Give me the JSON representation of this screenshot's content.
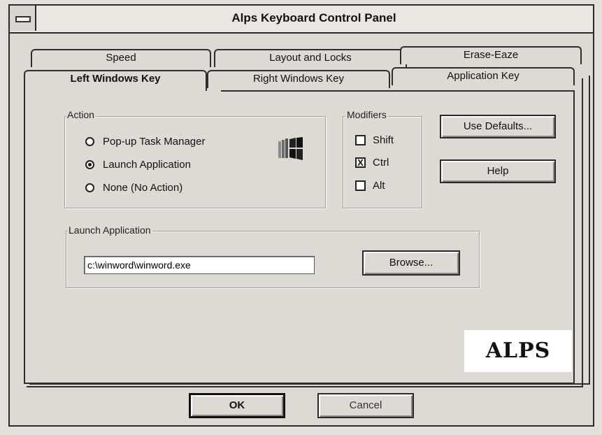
{
  "window": {
    "title": "Alps Keyboard Control Panel"
  },
  "tabs": {
    "back": [
      {
        "label": "Speed"
      },
      {
        "label": "Layout and Locks"
      },
      {
        "label": "Erase-Eaze"
      }
    ],
    "front": [
      {
        "label": "Left Windows Key",
        "active": true
      },
      {
        "label": "Right Windows Key"
      },
      {
        "label": "Application Key"
      }
    ]
  },
  "action": {
    "legend": "Action",
    "options": [
      {
        "label": "Pop-up Task Manager",
        "selected": false
      },
      {
        "label": "Launch Application",
        "selected": true
      },
      {
        "label": "None (No Action)",
        "selected": false
      }
    ]
  },
  "modifiers": {
    "legend": "Modifiers",
    "items": [
      {
        "label": "Shift",
        "checked": false
      },
      {
        "label": "Ctrl",
        "checked": true
      },
      {
        "label": "Alt",
        "checked": false
      }
    ]
  },
  "buttons": {
    "use_defaults": "Use Defaults...",
    "help": "Help",
    "browse": "Browse...",
    "ok": "OK",
    "cancel": "Cancel"
  },
  "launch": {
    "legend": "Launch Application",
    "path": "c:\\winword\\winword.exe"
  },
  "logo": "ALPS",
  "check_mark": "X"
}
